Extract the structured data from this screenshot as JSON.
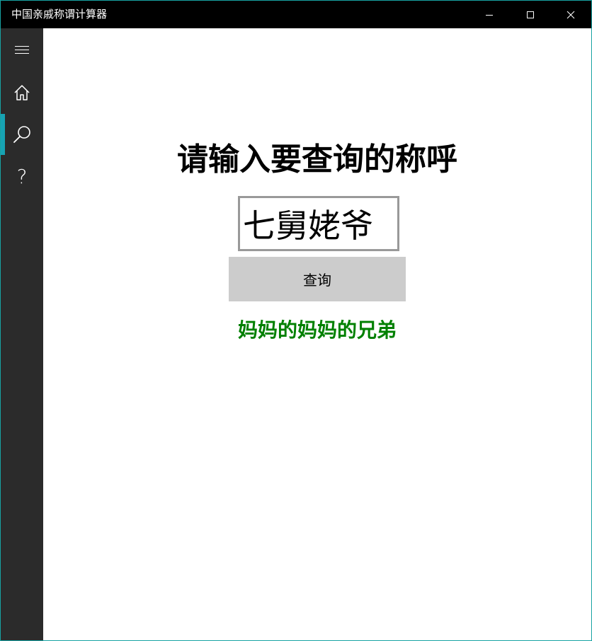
{
  "window": {
    "title": "中国亲戚称谓计算器",
    "controls": [
      "minimize-icon",
      "maximize-icon",
      "close-icon"
    ]
  },
  "sidebar": {
    "items": [
      {
        "name": "menu",
        "icon": "hamburger-menu-icon"
      },
      {
        "name": "home",
        "icon": "home-icon"
      },
      {
        "name": "search",
        "icon": "search-icon",
        "selected": true
      },
      {
        "name": "help",
        "icon": "help-icon",
        "glyph": "?"
      }
    ],
    "accent_color": "#17a3b3",
    "background_color": "#2b2b2b"
  },
  "main": {
    "prompt": "请输入要查询的称呼",
    "input": {
      "value": "七舅姥爷",
      "placeholder": ""
    },
    "query_button_label": "查询",
    "result": "妈妈的妈妈的兄弟",
    "result_color": "#008000"
  }
}
